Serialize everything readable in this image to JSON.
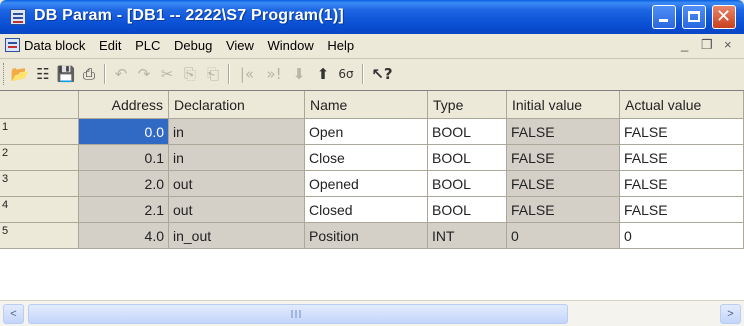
{
  "window": {
    "title": "DB Param - [DB1 -- 2222\\S7 Program(1)]"
  },
  "menu": {
    "items": [
      "Data block",
      "Edit",
      "PLC",
      "Debug",
      "View",
      "Window",
      "Help"
    ],
    "mdi_controls": [
      "_",
      "❒",
      "×"
    ]
  },
  "toolbar": {
    "buttons": [
      {
        "name": "open-icon",
        "glyph": "📂",
        "enabled": true
      },
      {
        "name": "network-icon",
        "glyph": "☷",
        "enabled": true
      },
      {
        "name": "save-icon",
        "glyph": "💾",
        "enabled": true
      },
      {
        "name": "print-icon",
        "glyph": "⎙",
        "enabled": true
      },
      {
        "name": "undo-icon",
        "glyph": "↶",
        "enabled": false
      },
      {
        "name": "redo-icon",
        "glyph": "↷",
        "enabled": false
      },
      {
        "name": "cut-icon",
        "glyph": "✂",
        "enabled": false
      },
      {
        "name": "copy-icon",
        "glyph": "⎘",
        "enabled": false
      },
      {
        "name": "paste-icon",
        "glyph": "⎗",
        "enabled": false
      },
      {
        "name": "insert-before-icon",
        "glyph": "|«",
        "enabled": false
      },
      {
        "name": "insert-after-icon",
        "glyph": "»!",
        "enabled": false
      },
      {
        "name": "download-icon",
        "glyph": "⬇",
        "enabled": false
      },
      {
        "name": "upload-icon",
        "glyph": "⬆",
        "enabled": true
      },
      {
        "name": "monitor-icon",
        "glyph": "6σ",
        "enabled": true
      },
      {
        "name": "help-pointer-icon",
        "glyph": "↖?",
        "enabled": true
      }
    ]
  },
  "table": {
    "columns": [
      "Address",
      "Declaration",
      "Name",
      "Type",
      "Initial value",
      "Actual value"
    ],
    "rows": [
      {
        "num": "1",
        "address": "0.0",
        "declaration": "in",
        "name": "Open",
        "type": "BOOL",
        "initial": "FALSE",
        "actual": "FALSE"
      },
      {
        "num": "2",
        "address": "0.1",
        "declaration": "in",
        "name": "Close",
        "type": "BOOL",
        "initial": "FALSE",
        "actual": "FALSE"
      },
      {
        "num": "3",
        "address": "2.0",
        "declaration": "out",
        "name": "Opened",
        "type": "BOOL",
        "initial": "FALSE",
        "actual": "FALSE"
      },
      {
        "num": "4",
        "address": "2.1",
        "declaration": "out",
        "name": "Closed",
        "type": "BOOL",
        "initial": "FALSE",
        "actual": "FALSE"
      },
      {
        "num": "5",
        "address": "4.0",
        "declaration": "in_out",
        "name": "Position",
        "type": "INT",
        "initial": "0",
        "actual": "0"
      }
    ]
  },
  "scrollbar": {
    "left_arrow": "<",
    "right_arrow": ">"
  }
}
